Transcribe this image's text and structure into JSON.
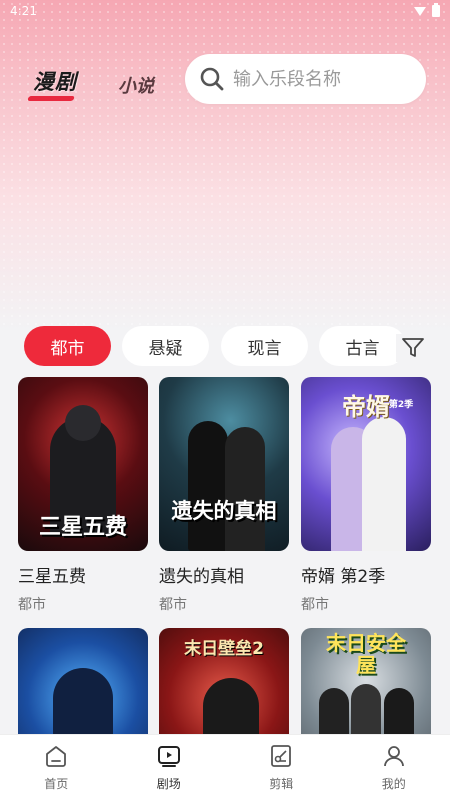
{
  "status_bar": {
    "time": "4:21"
  },
  "header": {
    "tab_drama": "漫剧",
    "tab_novel": "小说",
    "search_placeholder": "输入乐段名称"
  },
  "categories": [
    {
      "label": "都市",
      "active": true
    },
    {
      "label": "悬疑",
      "active": false
    },
    {
      "label": "现言",
      "active": false
    },
    {
      "label": "古言",
      "active": false
    }
  ],
  "cards": [
    {
      "title": "三星五费",
      "tag": "都市",
      "cover_text": "三星五费"
    },
    {
      "title": "遗失的真相",
      "tag": "都市",
      "cover_text": "遗失的真相"
    },
    {
      "title": "帝婿 第2季",
      "tag": "都市",
      "cover_text": "帝婿",
      "cover_sub": "第2季"
    },
    {
      "title": "",
      "tag": "",
      "cover_text": ""
    },
    {
      "title": "",
      "tag": "",
      "cover_text": "末日壁垒2"
    },
    {
      "title": "",
      "tag": "",
      "cover_text": "末日安全屋"
    }
  ],
  "bottom_nav": [
    {
      "label": "首页",
      "icon": "home-icon"
    },
    {
      "label": "剧场",
      "icon": "theater-icon"
    },
    {
      "label": "剪辑",
      "icon": "edit-icon"
    },
    {
      "label": "我的",
      "icon": "profile-icon"
    }
  ],
  "colors": {
    "accent": "#ee2a3b"
  }
}
